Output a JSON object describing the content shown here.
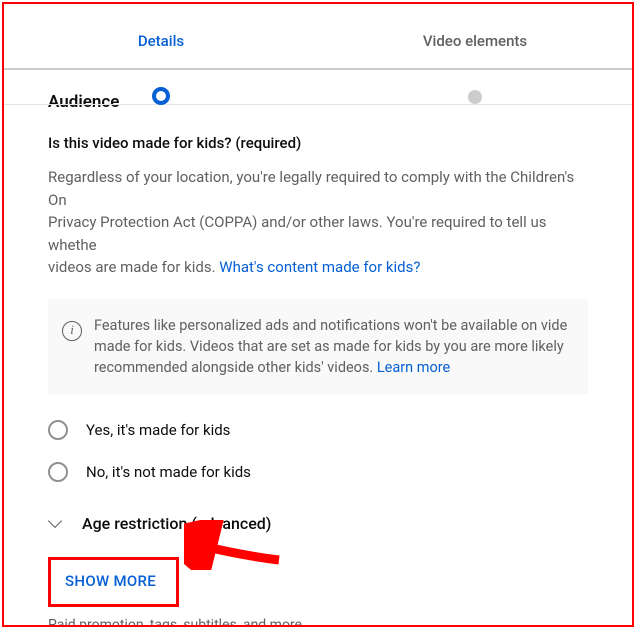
{
  "stepper": {
    "step1": "Details",
    "step2": "Video elements"
  },
  "audience": {
    "title": "Audience",
    "question": "Is this video made for kids? (required)",
    "desc_part1": "Regardless of your location, you're legally required to comply with the Children's On",
    "desc_part2": "Privacy Protection Act (COPPA) and/or other laws. You're required to tell us whethe",
    "desc_part3": "videos are made for kids. ",
    "desc_link": "What's content made for kids?",
    "info_text": "Features like personalized ads and notifications won't be available on vide made for kids. Videos that are set as made for kids by you are more likely recommended alongside other kids' videos. ",
    "info_link": "Learn more",
    "radio_yes": "Yes, it's made for kids",
    "radio_no": "No, it's not made for kids",
    "age_restriction": "Age restriction (advanced)"
  },
  "show_more": {
    "label": "SHOW MORE",
    "subtext": "Paid promotion, tags, subtitles, and more"
  }
}
